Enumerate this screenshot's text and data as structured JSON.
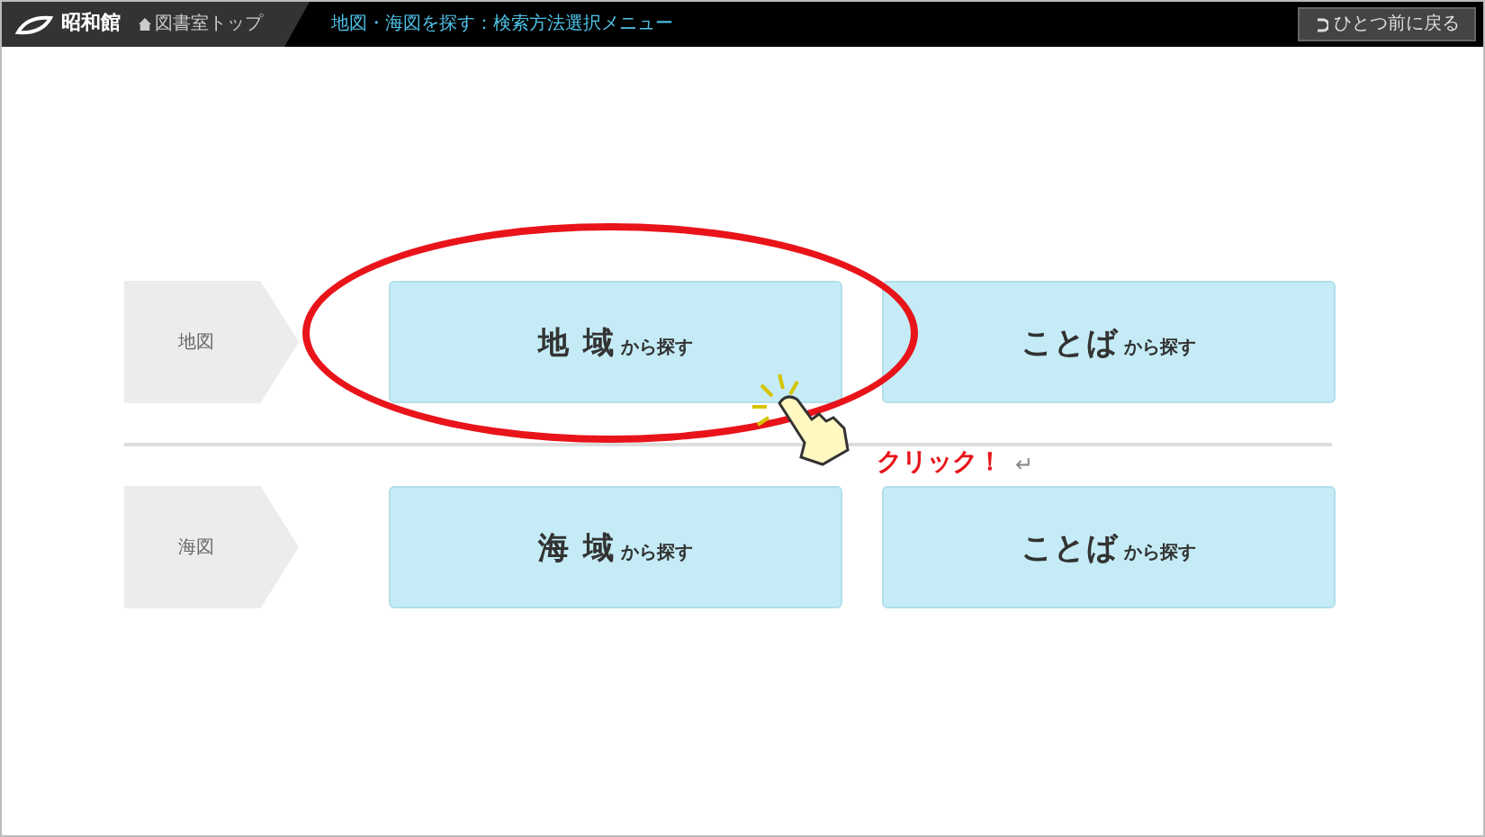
{
  "header": {
    "logo": "昭和館",
    "top_link": "図書室トップ",
    "breadcrumb": "地図・海図を探す：検索方法選択メニュー",
    "back_button": "ひとつ前に戻る"
  },
  "sections": [
    {
      "label": "地図",
      "buttons": [
        {
          "main": "地 域",
          "sub": "から探す"
        },
        {
          "main": "ことば",
          "sub": "から探す"
        }
      ]
    },
    {
      "label": "海図",
      "buttons": [
        {
          "main": "海 域",
          "sub": "から探す"
        },
        {
          "main": "ことば",
          "sub": "から探す"
        }
      ]
    }
  ],
  "annotation": {
    "text": "クリック！",
    "return_mark": "↵"
  }
}
